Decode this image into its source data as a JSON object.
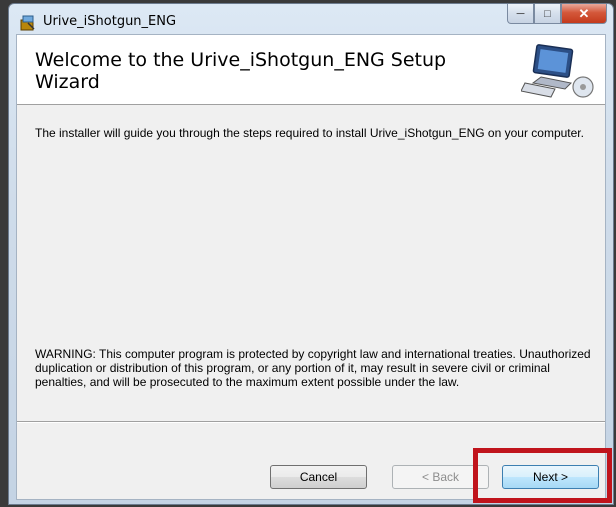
{
  "window": {
    "title": "Urive_iShotgun_ENG",
    "app_icon": "installer-icon",
    "caption_buttons": {
      "minimize": "minimize-icon",
      "maximize": "maximize-icon",
      "close": "close-icon"
    }
  },
  "banner": {
    "title": "Welcome to the Urive_iShotgun_ENG Setup Wizard",
    "icon": "computer-setup-icon"
  },
  "body": {
    "intro": "The installer will guide you through the steps required to install Urive_iShotgun_ENG on your computer.",
    "warning": "WARNING: This computer program is protected by copyright law and international treaties. Unauthorized duplication or distribution of this program, or any portion of it, may result in severe civil or criminal penalties, and will be prosecuted to the maximum extent possible under the law."
  },
  "buttons": {
    "cancel": "Cancel",
    "back": "< Back",
    "next": "Next >"
  },
  "colors": {
    "highlight": "#c0141c",
    "close_button": "#c43a1c"
  }
}
